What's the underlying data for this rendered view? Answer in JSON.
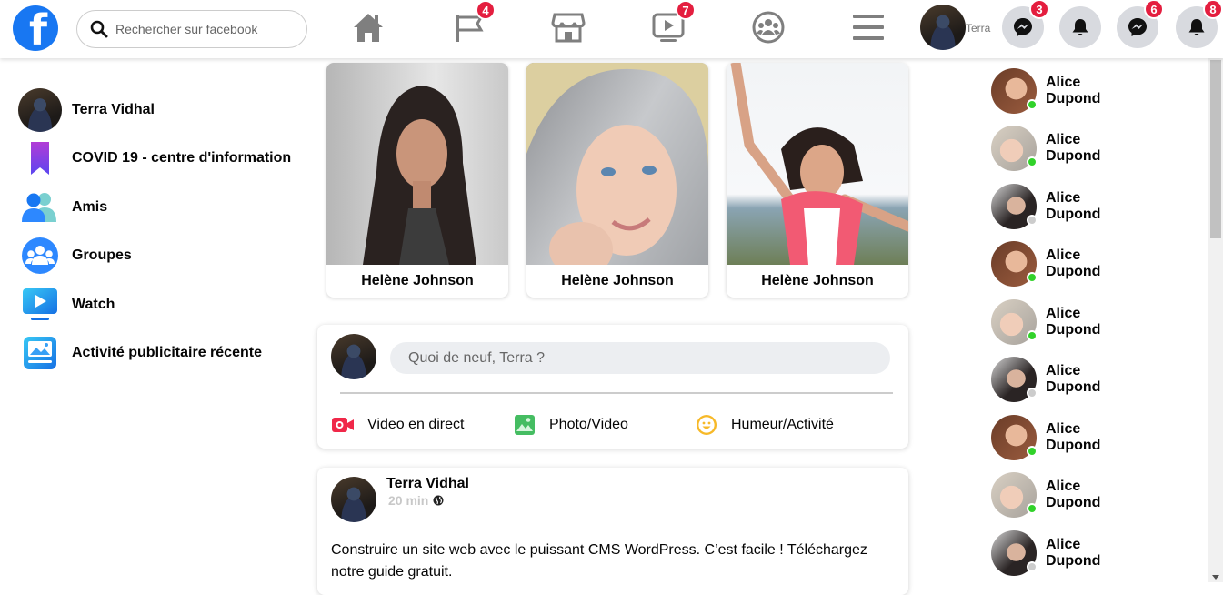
{
  "header": {
    "logo_letter": "f",
    "search_placeholder": "Rechercher sur facebook",
    "nav": [
      {
        "name": "home",
        "badge": ""
      },
      {
        "name": "pages",
        "badge": "4"
      },
      {
        "name": "marketplace",
        "badge": ""
      },
      {
        "name": "watch",
        "badge": "7"
      },
      {
        "name": "groups",
        "badge": ""
      },
      {
        "name": "menu",
        "badge": ""
      }
    ],
    "user_name": "Terra",
    "actions": [
      {
        "name": "messenger",
        "badge": "3"
      },
      {
        "name": "notifications",
        "badge": ""
      },
      {
        "name": "messenger",
        "badge": "6"
      },
      {
        "name": "notifications",
        "badge": "8"
      }
    ]
  },
  "sidebar": {
    "items": [
      {
        "label": "Terra Vidhal",
        "icon": "user-avatar"
      },
      {
        "label": "COVID 19 - centre d'information",
        "icon": "covid-bookmark-icon"
      },
      {
        "label": "Amis",
        "icon": "friends-icon"
      },
      {
        "label": "Groupes",
        "icon": "groups-icon"
      },
      {
        "label": "Watch",
        "icon": "watch-icon"
      },
      {
        "label": "Activité publicitaire récente",
        "icon": "ads-activity-icon"
      }
    ]
  },
  "stories": [
    {
      "name": "Helène Johnson"
    },
    {
      "name": "Helène Johnson"
    },
    {
      "name": "Helène Johnson"
    }
  ],
  "composer": {
    "placeholder": "Quoi de neuf, Terra ?",
    "actions": [
      {
        "label": "Video en direct",
        "icon": "live-video-icon",
        "color": "#f02849"
      },
      {
        "label": "Photo/Video",
        "icon": "photo-icon",
        "color": "#45bd62"
      },
      {
        "label": "Humeur/Activité",
        "icon": "feeling-icon",
        "color": "#f7b928"
      }
    ]
  },
  "post": {
    "author": "Terra Vidhal",
    "time": "20 min",
    "text": "Construire un site web avec le puissant CMS WordPress. C’est facile ! Téléchargez notre guide gratuit."
  },
  "contacts": [
    {
      "first": "Alice",
      "last": "Dupond",
      "online": true
    },
    {
      "first": "Alice",
      "last": "Dupond",
      "online": true
    },
    {
      "first": "Alice",
      "last": "Dupond",
      "online": false
    },
    {
      "first": "Alice",
      "last": "Dupond",
      "online": true
    },
    {
      "first": "Alice",
      "last": "Dupond",
      "online": true
    },
    {
      "first": "Alice",
      "last": "Dupond",
      "online": false
    },
    {
      "first": "Alice",
      "last": "Dupond",
      "online": true
    },
    {
      "first": "Alice",
      "last": "Dupond",
      "online": true
    },
    {
      "first": "Alice",
      "last": "Dupond",
      "online": false
    }
  ],
  "colors": {
    "brand": "#1877f2",
    "badge": "#e41e3f",
    "online": "#31d22a",
    "offline": "#cccccc"
  }
}
